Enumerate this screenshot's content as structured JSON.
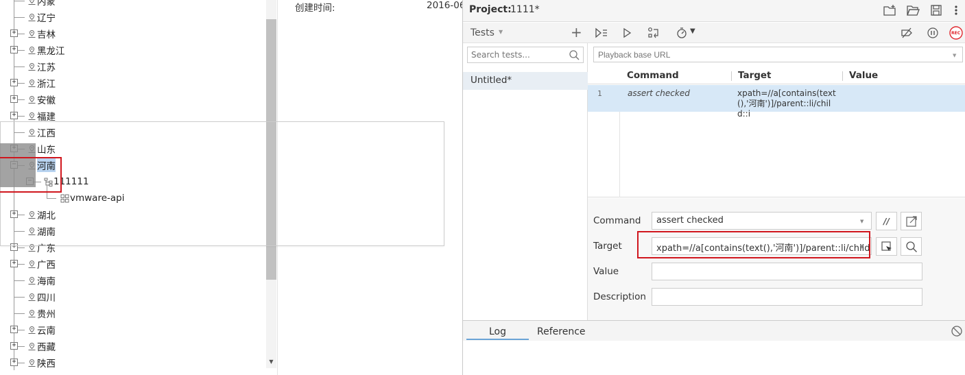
{
  "tree": {
    "nodes": [
      {
        "label": "内蒙",
        "expandable": false
      },
      {
        "label": "辽宁",
        "expandable": false
      },
      {
        "label": "吉林",
        "expandable": true
      },
      {
        "label": "黑龙江",
        "expandable": true
      },
      {
        "label": "江苏",
        "expandable": false
      },
      {
        "label": "浙江",
        "expandable": true
      },
      {
        "label": "安徽",
        "expandable": true
      },
      {
        "label": "福建",
        "expandable": true
      },
      {
        "label": "江西",
        "expandable": false
      },
      {
        "label": "山东",
        "expandable": true
      },
      {
        "label": "河南",
        "expandable": true,
        "expanded": true,
        "selected": true
      },
      {
        "label": "111111",
        "expandable": true,
        "expanded": true,
        "child": true
      },
      {
        "label": "vmware-api",
        "expandable": false,
        "grandchild": true
      },
      {
        "label": "湖北",
        "expandable": true
      },
      {
        "label": "湖南",
        "expandable": false
      },
      {
        "label": "广东",
        "expandable": true
      },
      {
        "label": "广西",
        "expandable": true
      },
      {
        "label": "海南",
        "expandable": false
      },
      {
        "label": "四川",
        "expandable": false
      },
      {
        "label": "贵州",
        "expandable": false
      },
      {
        "label": "云南",
        "expandable": true
      },
      {
        "label": "西藏",
        "expandable": true
      },
      {
        "label": "陕西",
        "expandable": true
      }
    ],
    "scroll_down_glyph": "▼"
  },
  "detail": {
    "created_label": "创建时间:",
    "created_value": "2016-06"
  },
  "ide": {
    "project_label": "Project:",
    "project_name": "1111*",
    "tests_title": "Tests",
    "tests_add": "+",
    "tests_caret": "▼",
    "search_placeholder": "Search tests...",
    "test_items": [
      "Untitled*"
    ],
    "playback_placeholder": "Playback base URL",
    "grid_headers": {
      "command": "Command",
      "target": "Target",
      "value": "Value"
    },
    "rows": [
      {
        "num": "1",
        "command": "assert checked",
        "target": "xpath=//a[contains(text(),'河南')]/parent::li/child::i",
        "value": ""
      }
    ],
    "form": {
      "command_label": "Command",
      "command_value": "assert checked",
      "comment_btn": "//",
      "target_label": "Target",
      "target_value": "xpath=//a[contains(text(),'河南')]/parent::li/child::i",
      "value_label": "Value",
      "value_value": "",
      "description_label": "Description",
      "description_value": ""
    },
    "log_tabs": [
      "Log",
      "Reference"
    ],
    "caret": "▼",
    "record_label": "REC"
  },
  "colors": {
    "highlight_red": "#d0161d",
    "selected_row": "#d7e8f7",
    "tree_selected": "#b8d3f0",
    "record_red": "#e0262d"
  }
}
